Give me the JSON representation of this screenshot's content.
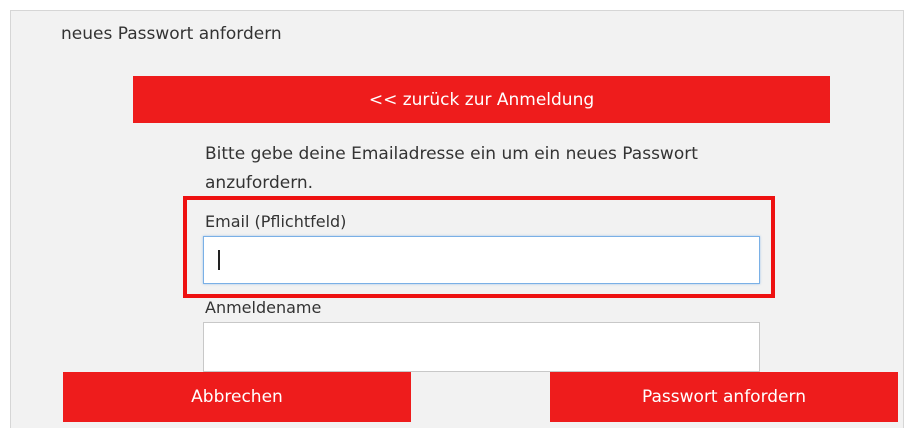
{
  "page": {
    "title": "neues Passwort anfordern"
  },
  "back_button": {
    "label": "<< zurück zur Anmeldung"
  },
  "instruction": "Bitte gebe deine Emailadresse ein um ein neues Passwort anzufordern.",
  "form": {
    "email": {
      "label": "Email (Pflichtfeld)",
      "value": ""
    },
    "username": {
      "label": "Anmeldename",
      "value": ""
    }
  },
  "actions": {
    "cancel_label": "Abbrechen",
    "submit_label": "Passwort anfordern"
  },
  "colors": {
    "accent": "#ee1c1c",
    "highlight": "#ee1111",
    "panel_bg": "#f2f2f2"
  }
}
